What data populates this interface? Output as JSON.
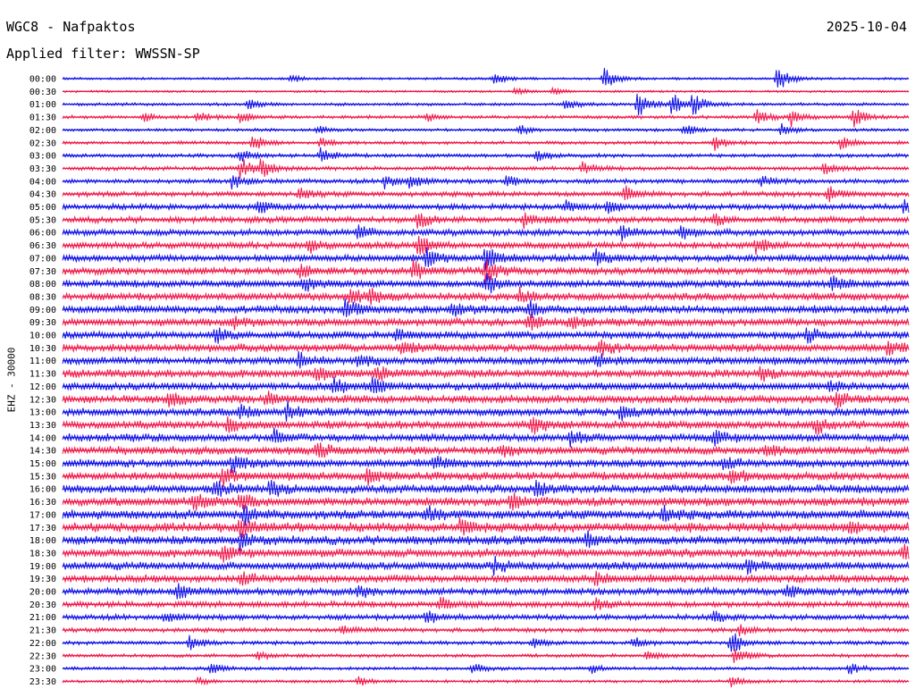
{
  "header": {
    "station": "WGC8 - Nafpaktos",
    "date": "2025-10-04",
    "filter": "Applied filter: WWSSN-SP"
  },
  "chart_data": {
    "type": "line",
    "channel_label": "EHZ - 30000",
    "colors": [
      "#1010e8",
      "#f0184a"
    ],
    "lines": [
      {
        "time": "00:00",
        "noise": 0.18,
        "events": [
          {
            "pos": 0.64,
            "amp": 1.6
          },
          {
            "pos": 0.845,
            "amp": 1.7
          },
          {
            "pos": 0.51,
            "amp": 0.8
          },
          {
            "pos": 0.27,
            "amp": 0.5
          }
        ]
      },
      {
        "time": "00:30",
        "noise": 0.16,
        "events": [
          {
            "pos": 0.535,
            "amp": 0.5
          },
          {
            "pos": 0.58,
            "amp": 0.4
          }
        ]
      },
      {
        "time": "01:00",
        "noise": 0.22,
        "events": [
          {
            "pos": 0.68,
            "amp": 1.8
          },
          {
            "pos": 0.72,
            "amp": 1.5
          },
          {
            "pos": 0.745,
            "amp": 1.3
          },
          {
            "pos": 0.595,
            "amp": 0.7
          },
          {
            "pos": 0.22,
            "amp": 0.6
          }
        ]
      },
      {
        "time": "01:30",
        "noise": 0.25,
        "events": [
          {
            "pos": 0.095,
            "amp": 0.6
          },
          {
            "pos": 0.16,
            "amp": 0.7
          },
          {
            "pos": 0.21,
            "amp": 0.7
          },
          {
            "pos": 0.43,
            "amp": 0.6
          },
          {
            "pos": 0.82,
            "amp": 1.0
          },
          {
            "pos": 0.86,
            "amp": 1.2
          },
          {
            "pos": 0.935,
            "amp": 1.3
          }
        ]
      },
      {
        "time": "02:00",
        "noise": 0.22,
        "events": [
          {
            "pos": 0.3,
            "amp": 0.5
          },
          {
            "pos": 0.54,
            "amp": 0.6
          },
          {
            "pos": 0.735,
            "amp": 0.9
          },
          {
            "pos": 0.85,
            "amp": 0.8
          }
        ]
      },
      {
        "time": "02:30",
        "noise": 0.25,
        "events": [
          {
            "pos": 0.225,
            "amp": 1.2
          },
          {
            "pos": 0.77,
            "amp": 1.0
          },
          {
            "pos": 0.92,
            "amp": 0.9
          },
          {
            "pos": 0.305,
            "amp": 0.6
          }
        ]
      },
      {
        "time": "03:00",
        "noise": 0.27,
        "events": [
          {
            "pos": 0.305,
            "amp": 1.1
          },
          {
            "pos": 0.56,
            "amp": 0.7
          },
          {
            "pos": 0.21,
            "amp": 0.8
          }
        ]
      },
      {
        "time": "03:30",
        "noise": 0.3,
        "events": [
          {
            "pos": 0.21,
            "amp": 1.4
          },
          {
            "pos": 0.235,
            "amp": 1.2
          },
          {
            "pos": 0.615,
            "amp": 0.8
          },
          {
            "pos": 0.9,
            "amp": 0.7
          }
        ]
      },
      {
        "time": "04:00",
        "noise": 0.33,
        "events": [
          {
            "pos": 0.2,
            "amp": 1.0
          },
          {
            "pos": 0.38,
            "amp": 1.0
          },
          {
            "pos": 0.41,
            "amp": 0.9
          },
          {
            "pos": 0.525,
            "amp": 0.8
          },
          {
            "pos": 0.825,
            "amp": 0.8
          }
        ]
      },
      {
        "time": "04:30",
        "noise": 0.38,
        "events": [
          {
            "pos": 0.28,
            "amp": 0.8
          },
          {
            "pos": 0.665,
            "amp": 0.9
          },
          {
            "pos": 0.905,
            "amp": 0.9
          }
        ]
      },
      {
        "time": "05:00",
        "noise": 0.42,
        "events": [
          {
            "pos": 0.23,
            "amp": 0.9
          },
          {
            "pos": 0.595,
            "amp": 0.8
          },
          {
            "pos": 0.645,
            "amp": 1.0
          },
          {
            "pos": 0.995,
            "amp": 0.8
          }
        ]
      },
      {
        "time": "05:30",
        "noise": 0.45,
        "events": [
          {
            "pos": 0.42,
            "amp": 1.1
          },
          {
            "pos": 0.545,
            "amp": 1.0
          },
          {
            "pos": 0.77,
            "amp": 0.8
          }
        ]
      },
      {
        "time": "06:00",
        "noise": 0.46,
        "events": [
          {
            "pos": 0.35,
            "amp": 1.0
          },
          {
            "pos": 0.66,
            "amp": 1.0
          },
          {
            "pos": 0.73,
            "amp": 0.9
          }
        ]
      },
      {
        "time": "06:30",
        "noise": 0.5,
        "events": [
          {
            "pos": 0.42,
            "amp": 1.3
          },
          {
            "pos": 0.29,
            "amp": 0.9
          },
          {
            "pos": 0.82,
            "amp": 0.9
          }
        ]
      },
      {
        "time": "07:00",
        "noise": 0.5,
        "events": [
          {
            "pos": 0.43,
            "amp": 1.2
          },
          {
            "pos": 0.5,
            "amp": 1.5
          },
          {
            "pos": 0.63,
            "amp": 0.9
          }
        ]
      },
      {
        "time": "07:30",
        "noise": 0.52,
        "events": [
          {
            "pos": 0.415,
            "amp": 1.3
          },
          {
            "pos": 0.5,
            "amp": 1.6
          },
          {
            "pos": 0.28,
            "amp": 0.9
          }
        ]
      },
      {
        "time": "08:00",
        "noise": 0.55,
        "events": [
          {
            "pos": 0.5,
            "amp": 1.5
          },
          {
            "pos": 0.285,
            "amp": 0.9
          },
          {
            "pos": 0.91,
            "amp": 0.8
          }
        ]
      },
      {
        "time": "08:30",
        "noise": 0.55,
        "events": [
          {
            "pos": 0.34,
            "amp": 1.2
          },
          {
            "pos": 0.365,
            "amp": 0.9
          },
          {
            "pos": 0.54,
            "amp": 1.0
          }
        ]
      },
      {
        "time": "09:00",
        "noise": 0.58,
        "events": [
          {
            "pos": 0.335,
            "amp": 1.3
          },
          {
            "pos": 0.46,
            "amp": 1.0
          },
          {
            "pos": 0.55,
            "amp": 1.1
          }
        ]
      },
      {
        "time": "09:30",
        "noise": 0.55,
        "events": [
          {
            "pos": 0.55,
            "amp": 1.0
          },
          {
            "pos": 0.6,
            "amp": 0.8
          },
          {
            "pos": 0.2,
            "amp": 0.8
          }
        ]
      },
      {
        "time": "10:00",
        "noise": 0.55,
        "events": [
          {
            "pos": 0.18,
            "amp": 1.0
          },
          {
            "pos": 0.395,
            "amp": 0.9
          },
          {
            "pos": 0.88,
            "amp": 0.8
          }
        ]
      },
      {
        "time": "10:30",
        "noise": 0.58,
        "events": [
          {
            "pos": 0.4,
            "amp": 1.1
          },
          {
            "pos": 0.635,
            "amp": 0.9
          },
          {
            "pos": 0.975,
            "amp": 0.8
          }
        ]
      },
      {
        "time": "11:00",
        "noise": 0.58,
        "events": [
          {
            "pos": 0.28,
            "amp": 1.0
          },
          {
            "pos": 0.35,
            "amp": 0.9
          },
          {
            "pos": 0.63,
            "amp": 0.9
          }
        ]
      },
      {
        "time": "11:30",
        "noise": 0.58,
        "events": [
          {
            "pos": 0.3,
            "amp": 0.9
          },
          {
            "pos": 0.37,
            "amp": 1.0
          },
          {
            "pos": 0.825,
            "amp": 0.8
          }
        ]
      },
      {
        "time": "12:00",
        "noise": 0.58,
        "events": [
          {
            "pos": 0.32,
            "amp": 1.0
          },
          {
            "pos": 0.365,
            "amp": 1.1
          },
          {
            "pos": 0.905,
            "amp": 0.8
          }
        ]
      },
      {
        "time": "12:30",
        "noise": 0.58,
        "events": [
          {
            "pos": 0.125,
            "amp": 1.0
          },
          {
            "pos": 0.24,
            "amp": 1.0
          },
          {
            "pos": 0.915,
            "amp": 0.9
          }
        ]
      },
      {
        "time": "13:00",
        "noise": 0.58,
        "events": [
          {
            "pos": 0.21,
            "amp": 0.9
          },
          {
            "pos": 0.265,
            "amp": 1.1
          },
          {
            "pos": 0.66,
            "amp": 0.9
          }
        ]
      },
      {
        "time": "13:30",
        "noise": 0.58,
        "events": [
          {
            "pos": 0.195,
            "amp": 1.0
          },
          {
            "pos": 0.555,
            "amp": 1.1
          },
          {
            "pos": 0.89,
            "amp": 1.0
          }
        ]
      },
      {
        "time": "14:00",
        "noise": 0.58,
        "events": [
          {
            "pos": 0.25,
            "amp": 0.9
          },
          {
            "pos": 0.6,
            "amp": 0.9
          },
          {
            "pos": 0.77,
            "amp": 0.9
          }
        ]
      },
      {
        "time": "14:30",
        "noise": 0.6,
        "events": [
          {
            "pos": 0.3,
            "amp": 0.9
          },
          {
            "pos": 0.52,
            "amp": 0.8
          },
          {
            "pos": 0.83,
            "amp": 0.9
          }
        ]
      },
      {
        "time": "15:00",
        "noise": 0.6,
        "events": [
          {
            "pos": 0.2,
            "amp": 1.0
          },
          {
            "pos": 0.44,
            "amp": 0.8
          },
          {
            "pos": 0.78,
            "amp": 0.9
          }
        ]
      },
      {
        "time": "15:30",
        "noise": 0.6,
        "events": [
          {
            "pos": 0.19,
            "amp": 1.1
          },
          {
            "pos": 0.36,
            "amp": 0.9
          },
          {
            "pos": 0.79,
            "amp": 1.0
          }
        ]
      },
      {
        "time": "16:00",
        "noise": 0.62,
        "events": [
          {
            "pos": 0.18,
            "amp": 1.1
          },
          {
            "pos": 0.245,
            "amp": 1.0
          },
          {
            "pos": 0.56,
            "amp": 0.9
          }
        ]
      },
      {
        "time": "16:30",
        "noise": 0.65,
        "events": [
          {
            "pos": 0.155,
            "amp": 1.1
          },
          {
            "pos": 0.21,
            "amp": 1.0
          },
          {
            "pos": 0.53,
            "amp": 0.9
          }
        ]
      },
      {
        "time": "17:00",
        "noise": 0.68,
        "events": [
          {
            "pos": 0.215,
            "amp": 1.1
          },
          {
            "pos": 0.43,
            "amp": 0.9
          },
          {
            "pos": 0.71,
            "amp": 0.9
          }
        ]
      },
      {
        "time": "17:30",
        "noise": 0.7,
        "events": [
          {
            "pos": 0.21,
            "amp": 1.2
          },
          {
            "pos": 0.47,
            "amp": 0.9
          },
          {
            "pos": 0.93,
            "amp": 0.9
          }
        ]
      },
      {
        "time": "18:00",
        "noise": 0.65,
        "events": [
          {
            "pos": 0.21,
            "amp": 1.0
          },
          {
            "pos": 0.62,
            "amp": 0.9
          }
        ]
      },
      {
        "time": "18:30",
        "noise": 0.62,
        "events": [
          {
            "pos": 0.19,
            "amp": 0.9
          },
          {
            "pos": 0.995,
            "amp": 1.1
          }
        ]
      },
      {
        "time": "19:00",
        "noise": 0.6,
        "events": [
          {
            "pos": 0.51,
            "amp": 0.9
          },
          {
            "pos": 0.81,
            "amp": 0.9
          }
        ]
      },
      {
        "time": "19:30",
        "noise": 0.58,
        "events": [
          {
            "pos": 0.21,
            "amp": 0.9
          },
          {
            "pos": 0.63,
            "amp": 0.8
          }
        ]
      },
      {
        "time": "20:00",
        "noise": 0.5,
        "events": [
          {
            "pos": 0.135,
            "amp": 0.9
          },
          {
            "pos": 0.855,
            "amp": 0.9
          },
          {
            "pos": 0.35,
            "amp": 0.7
          }
        ]
      },
      {
        "time": "20:30",
        "noise": 0.45,
        "events": [
          {
            "pos": 0.445,
            "amp": 0.9
          },
          {
            "pos": 0.63,
            "amp": 0.7
          }
        ]
      },
      {
        "time": "21:00",
        "noise": 0.4,
        "events": [
          {
            "pos": 0.43,
            "amp": 0.8
          },
          {
            "pos": 0.77,
            "amp": 0.7
          },
          {
            "pos": 0.12,
            "amp": 0.6
          }
        ]
      },
      {
        "time": "21:30",
        "noise": 0.32,
        "events": [
          {
            "pos": 0.33,
            "amp": 0.6
          },
          {
            "pos": 0.8,
            "amp": 0.6
          }
        ]
      },
      {
        "time": "22:00",
        "noise": 0.28,
        "events": [
          {
            "pos": 0.15,
            "amp": 0.9
          },
          {
            "pos": 0.79,
            "amp": 1.6
          },
          {
            "pos": 0.555,
            "amp": 0.6
          },
          {
            "pos": 0.675,
            "amp": 0.7
          }
        ]
      },
      {
        "time": "22:30",
        "noise": 0.26,
        "events": [
          {
            "pos": 0.795,
            "amp": 1.2
          },
          {
            "pos": 0.69,
            "amp": 0.6
          },
          {
            "pos": 0.23,
            "amp": 0.6
          }
        ]
      },
      {
        "time": "23:00",
        "noise": 0.24,
        "events": [
          {
            "pos": 0.175,
            "amp": 0.8
          },
          {
            "pos": 0.485,
            "amp": 0.6
          },
          {
            "pos": 0.93,
            "amp": 0.7
          },
          {
            "pos": 0.625,
            "amp": 0.6
          }
        ]
      },
      {
        "time": "23:30",
        "noise": 0.22,
        "events": [
          {
            "pos": 0.35,
            "amp": 0.6
          },
          {
            "pos": 0.79,
            "amp": 0.7
          },
          {
            "pos": 0.16,
            "amp": 0.5
          }
        ]
      }
    ]
  }
}
